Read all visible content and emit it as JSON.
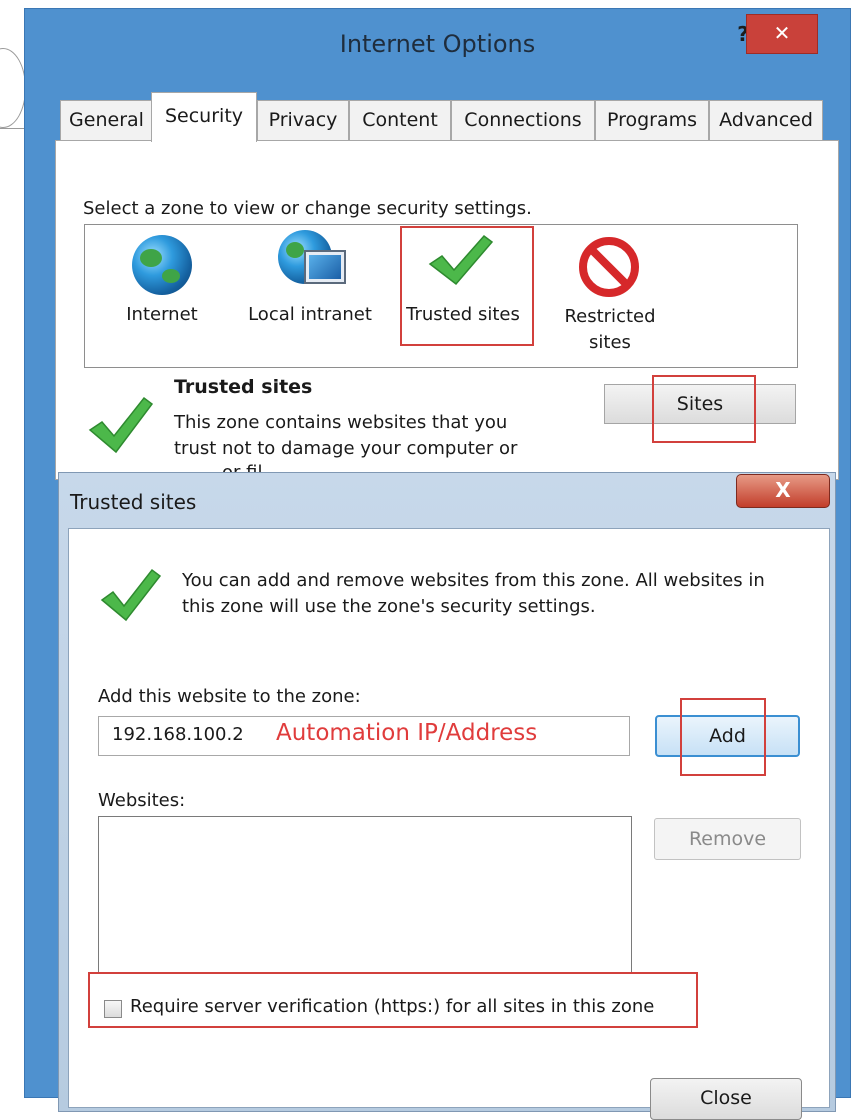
{
  "internet_options": {
    "title": "Internet Options",
    "help_glyph": "?",
    "close_glyph": "✕",
    "tabs": [
      {
        "label": "General"
      },
      {
        "label": "Security"
      },
      {
        "label": "Privacy"
      },
      {
        "label": "Content"
      },
      {
        "label": "Connections"
      },
      {
        "label": "Programs"
      },
      {
        "label": "Advanced"
      }
    ],
    "active_tab": "Security",
    "zone_prompt": "Select a zone to view or change security settings.",
    "zones": [
      {
        "label": "Internet",
        "icon": "globe-icon"
      },
      {
        "label": "Local intranet",
        "icon": "intranet-icon"
      },
      {
        "label": "Trusted sites",
        "icon": "checkmark-icon"
      },
      {
        "label_line1": "Restricted",
        "label_line2": "sites",
        "icon": "restricted-icon"
      }
    ],
    "selected_zone": {
      "heading": "Trusted sites",
      "desc_line1": "This zone contains websites that you",
      "desc_line2": "trust not to damage your computer or",
      "desc_line3": "or fil..."
    },
    "sites_button": "Sites"
  },
  "trusted_sites_dialog": {
    "title": "Trusted sites",
    "close_glyph": "X",
    "info_line1": "You can add and remove websites from this zone. All websites in",
    "info_line2": "this zone will use the zone's security settings.",
    "add_label": "Add this website to the zone:",
    "site_input_value": "192.168.100.2",
    "annotation": "Automation IP/Address",
    "add_button": "Add",
    "websites_label": "Websites:",
    "remove_button": "Remove",
    "require_https_label": "Require server verification (https:) for all sites in this zone",
    "require_https_checked": false,
    "close_button": "Close"
  },
  "colors": {
    "window_frame": "#4f91cf",
    "highlight_annotation": "#d2403c",
    "annotation_text": "#e03c3c"
  }
}
